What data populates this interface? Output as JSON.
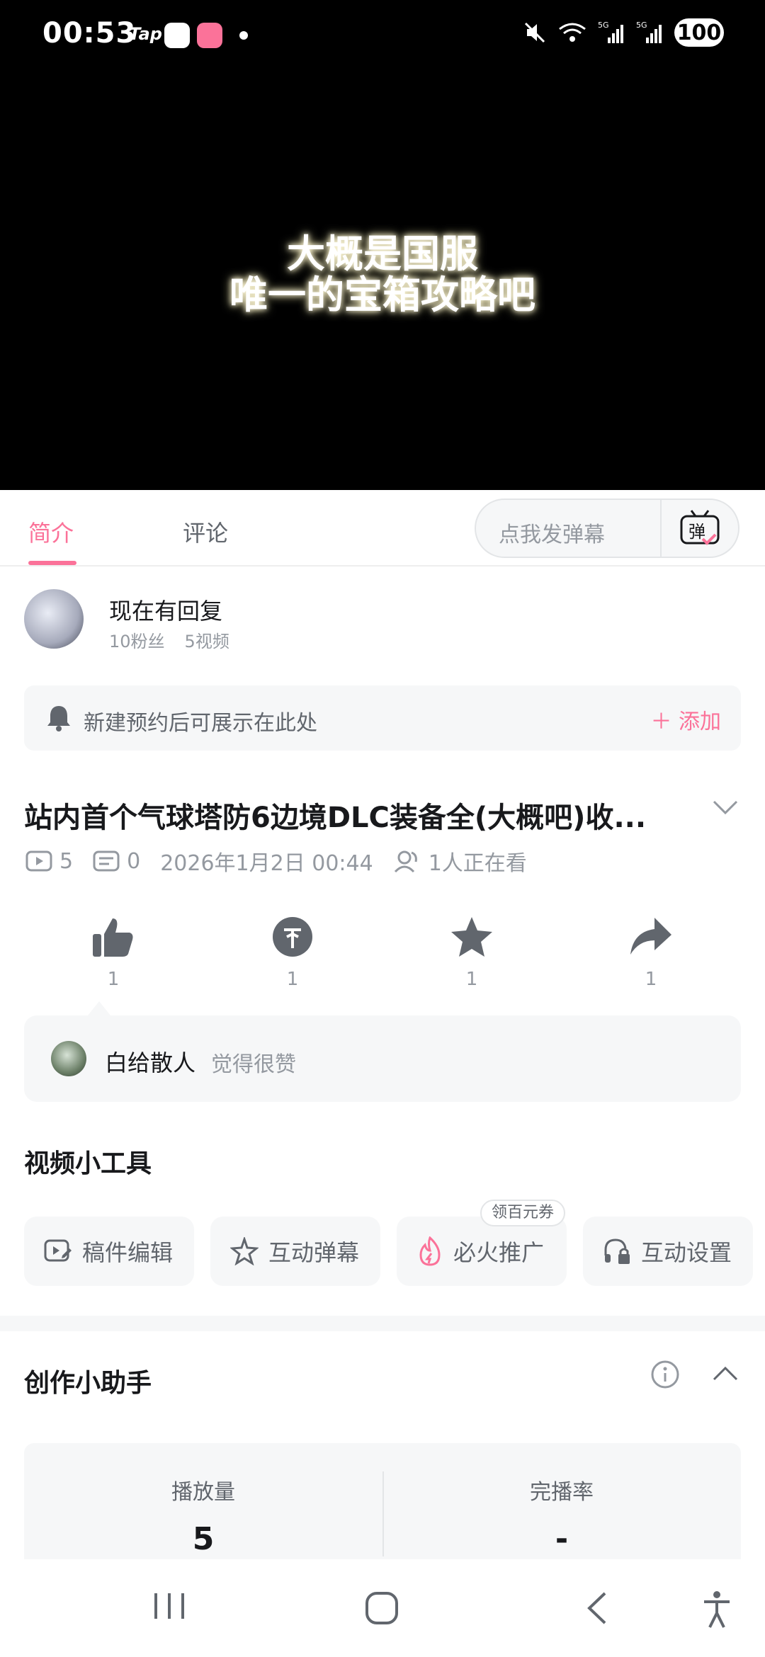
{
  "status_bar": {
    "time": "00:53",
    "tap_label": "Tap",
    "battery": "100"
  },
  "video": {
    "caption_line1": "大概是国服",
    "caption_line2": "唯一的宝箱攻略吧"
  },
  "tabs": [
    {
      "label": "简介"
    },
    {
      "label": "评论"
    }
  ],
  "danmaku": {
    "placeholder": "点我发弹幕",
    "button_label": "弹"
  },
  "author": {
    "name": "现在有回复",
    "fans": "10粉丝",
    "videos": "5视频"
  },
  "reservation": {
    "text": "新建预约后可展示在此处",
    "add_label": "添加"
  },
  "video_info": {
    "title": "站内首个气球塔防6边境DLC装备全(大概吧)收...",
    "plays": "5",
    "danmaku_count": "0",
    "date": "2026年1月2日 00:44",
    "watching": "1人正在看"
  },
  "actions": {
    "like": "1",
    "coin": "1",
    "favorite": "1",
    "share": "1"
  },
  "liked_by": {
    "user": "白给散人",
    "text": "觉得很赞"
  },
  "tools": {
    "title": "视频小工具",
    "items": [
      {
        "label": "稿件编辑",
        "icon": "video-edit-icon"
      },
      {
        "label": "互动弹幕",
        "icon": "sparkle-icon"
      },
      {
        "label": "必火推广",
        "icon": "flame-icon"
      },
      {
        "label": "互动设置",
        "icon": "headset-lock-icon"
      }
    ],
    "badge": "领百元券"
  },
  "assistant": {
    "title": "创作小助手",
    "stats": [
      {
        "label": "播放量",
        "value": "5"
      },
      {
        "label": "完播率",
        "value": "-"
      }
    ]
  },
  "colors": {
    "accent": "#fb7299",
    "text_secondary": "#9499a0",
    "surface": "#f6f7f8"
  }
}
